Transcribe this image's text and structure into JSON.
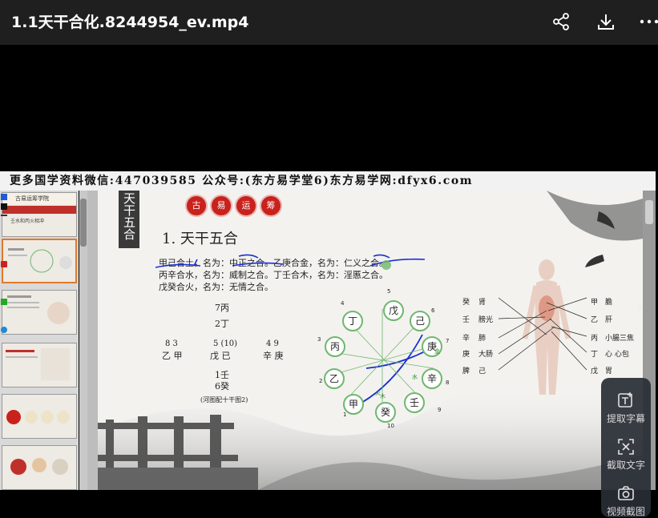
{
  "header": {
    "title": "1.1天干合化.8244954_ev.mp4",
    "icons": [
      "share-icon",
      "download-icon",
      "more-icon"
    ]
  },
  "banner": {
    "text": "更多国学资料微信:447039585 公众号:(东方易学堂6)东方易学网:dfyx6.com"
  },
  "thumbnails": {
    "first_title": "古易运筹学院",
    "second_caption": "壬水和丙火相冲"
  },
  "slide": {
    "vertical_title": "天干五合",
    "chips": [
      "古",
      "易",
      "运",
      "筹"
    ],
    "heading": "1. 天干五合",
    "lines": [
      "甲己合土，名为：中正之合。乙庚合金，名为：仁义之合。",
      "丙辛合水，名为：威制之合。丁壬合木，名为：淫慝之合。",
      "戊癸合火，名为：无情之合。"
    ],
    "hetu": {
      "top": [
        "7丙",
        "2丁"
      ],
      "left_nums": "8  3",
      "left_stems": "乙 甲",
      "center_nums": "5  (10)",
      "center_stems": "戊   已",
      "right_nums": "4  9",
      "right_stems": "辛 庚",
      "bottom": [
        "1壬",
        "6癸"
      ],
      "caption": "(河图配十干图2)"
    },
    "wheel": {
      "stems": [
        "戊",
        "己",
        "庚",
        "辛",
        "壬",
        "癸",
        "甲",
        "乙",
        "丙",
        "丁"
      ],
      "numbers": [
        "5",
        "6",
        "7",
        "8",
        "9",
        "10",
        "1",
        "2",
        "3",
        "4"
      ],
      "arrow_labels": [
        "金",
        "水",
        "木",
        "火"
      ]
    },
    "organs": {
      "left": [
        [
          "癸",
          "肾"
        ],
        [
          "壬",
          "膀光"
        ],
        [
          "辛",
          "肺"
        ],
        [
          "庚",
          "大肠"
        ],
        [
          "脾",
          "己"
        ]
      ],
      "right": [
        [
          "甲",
          "膽"
        ],
        [
          "乙",
          "肝"
        ],
        [
          "丙",
          "小腸三焦"
        ],
        [
          "丁",
          "心 心包"
        ],
        [
          "戊",
          "胃"
        ]
      ]
    }
  },
  "right_panel": {
    "items": [
      "提取字幕",
      "截取文字",
      "视频截图"
    ]
  },
  "colors": {
    "topbar": "#1f1f1f",
    "chip_red": "#c9211c",
    "stem_ring": "#6fb76e",
    "pen_blue": "#1a2fd0"
  }
}
